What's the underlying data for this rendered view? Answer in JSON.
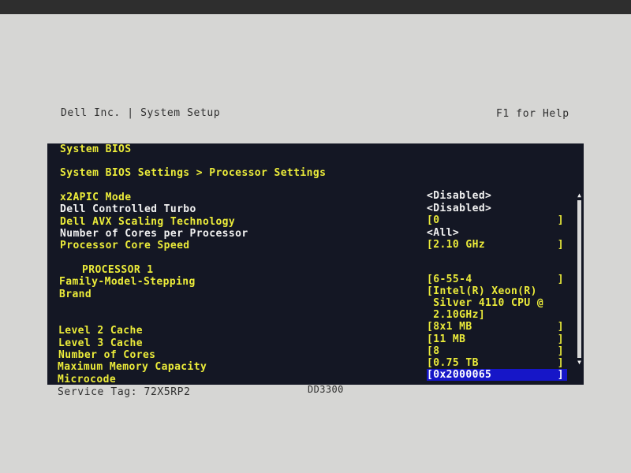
{
  "header": {
    "left": "Dell Inc. | System Setup",
    "right": "F1 for Help"
  },
  "bios": {
    "section_title": "System BIOS",
    "breadcrumb": "System BIOS Settings > Processor Settings",
    "settings": [
      {
        "label": "x2APIC Mode",
        "value": "<Disabled>",
        "color": "yellow"
      },
      {
        "label": "Dell Controlled Turbo",
        "value": "<Disabled>",
        "color": "white"
      },
      {
        "label": "Dell AVX Scaling Technology",
        "value": "[0",
        "close": "]",
        "color": "yellow"
      },
      {
        "label": "Number of Cores per Processor",
        "value": "<All>",
        "color": "white"
      },
      {
        "label": "Processor Core Speed",
        "value": "[2.10 GHz",
        "close": "]",
        "color": "yellow"
      }
    ],
    "processor": {
      "heading": "PROCESSOR 1",
      "family_label": "Family-Model-Stepping",
      "family_value": "[6-55-4",
      "family_close": "]",
      "brand_label": "Brand",
      "brand_value_lines": [
        "[Intel(R) Xeon(R)",
        " Silver 4110 CPU @",
        " 2.10GHz]"
      ],
      "rows": [
        {
          "label": "Level 2 Cache",
          "value": "[8x1 MB",
          "close": "]"
        },
        {
          "label": "Level 3 Cache",
          "value": "[11 MB",
          "close": "]"
        },
        {
          "label": "Number of Cores",
          "value": "[8",
          "close": "]"
        },
        {
          "label": "Maximum Memory Capacity",
          "value": "[0.75 TB",
          "close": "]"
        },
        {
          "label": "Microcode",
          "value": "[0x2000065",
          "close": "]"
        }
      ]
    }
  },
  "footer": {
    "service_tag": "Service Tag: 72X5RP2",
    "model": "DD3300"
  },
  "colors": {
    "screen_bg": "#141724",
    "yellow": "#ecec3a",
    "white": "#f2f2f2",
    "selection": "#1616c8"
  },
  "icons": {
    "scroll_up": "up-arrow-icon",
    "scroll_down": "down-arrow-icon"
  }
}
